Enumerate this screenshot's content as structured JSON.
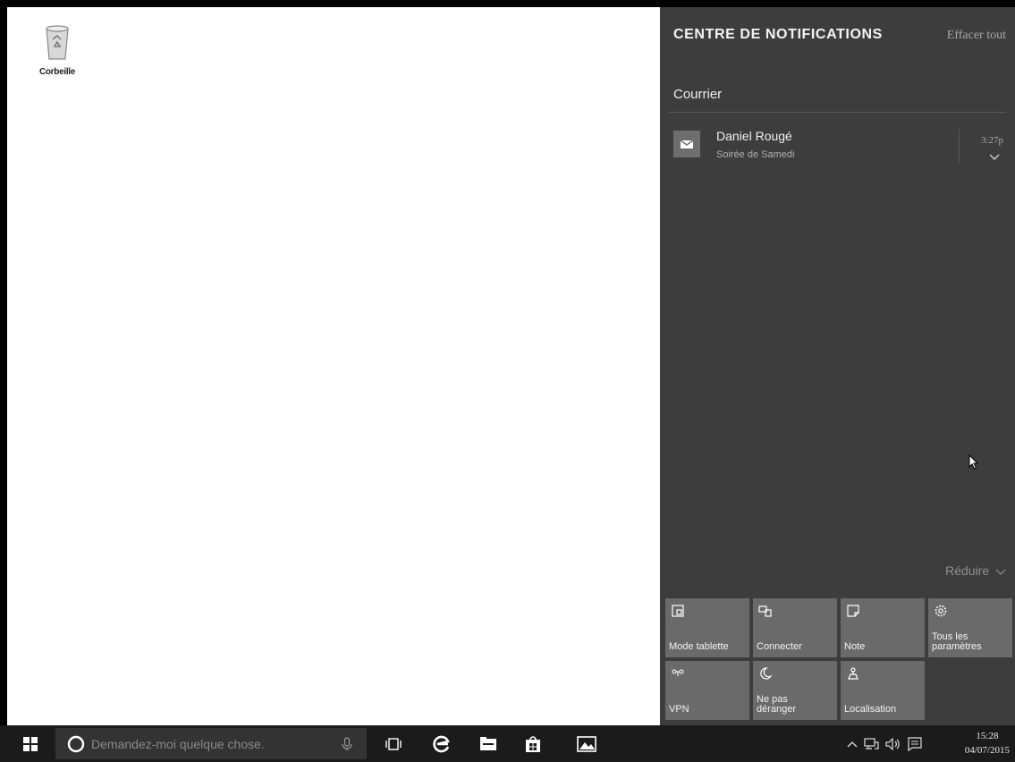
{
  "desktop": {
    "recycle_bin_label": "Corbeille"
  },
  "action_center": {
    "title": "CENTRE DE NOTIFICATIONS",
    "clear_all": "Effacer tout",
    "groups": [
      {
        "app": "Courrier",
        "notifications": [
          {
            "sender": "Daniel Rougé",
            "subject": "Soirée de Samedi",
            "time": "3:27p"
          }
        ]
      }
    ],
    "collapse_label": "Réduire",
    "quick_actions": [
      {
        "label": "Mode tablette",
        "icon": "tablet-mode-icon"
      },
      {
        "label": "Connecter",
        "icon": "connect-icon"
      },
      {
        "label": "Note",
        "icon": "note-icon"
      },
      {
        "label_line1": "Tous les",
        "label_line2": "paramètres",
        "icon": "settings-gear-icon"
      },
      {
        "label": "VPN",
        "icon": "vpn-icon"
      },
      {
        "label_line1": "Ne pas",
        "label_line2": "déranger",
        "icon": "moon-icon"
      },
      {
        "label": "Localisation",
        "icon": "location-icon"
      }
    ]
  },
  "taskbar": {
    "search_placeholder": "Demandez-moi quelque chose.",
    "clock_time": "15:28",
    "clock_date": "04/07/2015",
    "pinned": [
      "task-view-icon",
      "edge-icon",
      "file-explorer-icon",
      "store-icon",
      "photos-icon"
    ],
    "tray": [
      "chevron-up-icon",
      "network-icon",
      "volume-icon",
      "action-center-icon"
    ]
  },
  "colors": {
    "panel_bg": "#3d3d3d",
    "tile_bg": "#6a6a6a",
    "taskbar_bg": "#1b1b1b"
  }
}
